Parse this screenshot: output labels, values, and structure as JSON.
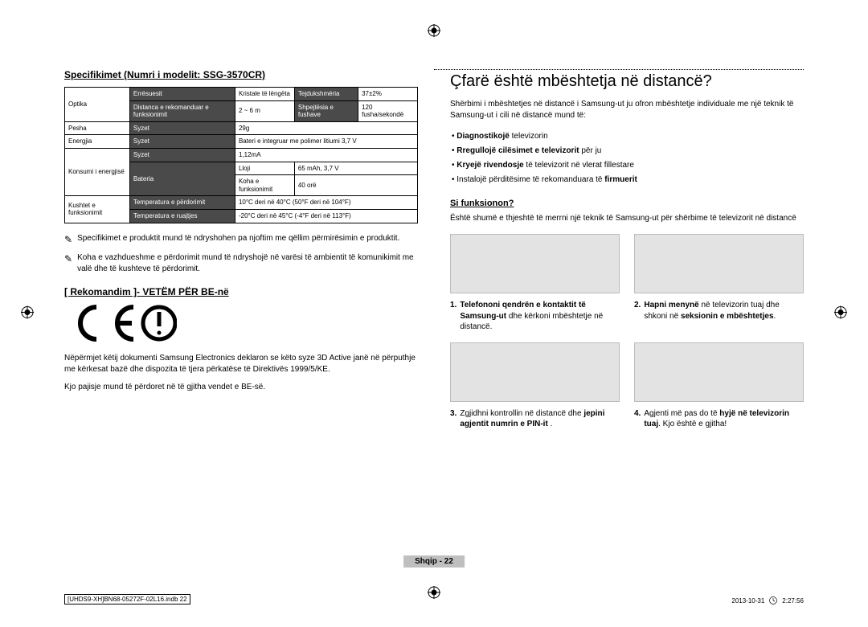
{
  "left": {
    "spec_heading": "Specifikimet (Numri i modelit: SSG-3570CR)",
    "table": {
      "r1c1": "Optika",
      "r1c2": "Errësuesit",
      "r1c3": "Kristale të lëngëta",
      "r1c4": "Tejdukshmëria",
      "r1c5": "37±2%",
      "r2c2": "Distanca e rekomanduar e funksionimit",
      "r2c3": "2 ~ 6 m",
      "r2c4": "Shpejtësia e fushave",
      "r2c5": "120 fusha/sekondë",
      "r3c1": "Pesha",
      "r3c2": "Syzet",
      "r3c3": "29g",
      "r4c1": "Energjia",
      "r4c2": "Syzet",
      "r4c3": "Bateri e integruar me polimer litiumi 3,7 V",
      "r5c1": "Konsumi i energjisë",
      "r5c2": "Syzet",
      "r5c3": "1,12mA",
      "r6c2": "Bateria",
      "r6c3a": "Lloji",
      "r6c3b": "65 mAh, 3,7 V",
      "r6c4a": "Koha e funksionimit",
      "r6c4b": "40 orë",
      "r7c1": "Kushtet e funksionimit",
      "r7c2": "Temperatura e përdorimit",
      "r7c3": "10°C deri në 40°C (50°F deri në 104°F)",
      "r8c2": "Temperatura e ruajtjes",
      "r8c3": "-20°C deri në 45°C (-4°F deri në 113°F)"
    },
    "note1": "Specifikimet e produktit mund të ndryshohen pa njoftim me qëllim përmirësimin e produktit.",
    "note2": "Koha e vazhdueshme e përdorimit mund të ndryshojë në varësi të ambientit të komunikimit me valë dhe të kushteve të përdorimit.",
    "rec_heading": "[ Rekomandim ]- VETËM PËR BE-në",
    "para1": "Nëpërmjet këtij dokumenti Samsung Electronics deklaron se këto syze 3D Active janë në përputhje me kërkesat bazë dhe dispozita të tjera përkatëse të Direktivës 1999/5/KE.",
    "para2": "Kjo pajisje mund të përdoret në të gjitha vendet e BE-së."
  },
  "right": {
    "title": "Çfarë është mbështetja në distancë?",
    "intro": "Shërbimi i mbështetjes në distancë i Samsung-ut ju ofron mbështetje individuale me një teknik të Samsung-ut i cili në distancë mund të:",
    "items": [
      {
        "b": "Diagnostikojë",
        "t": " televizorin"
      },
      {
        "b": "Rregullojë cilësimet e televizorit",
        "t": " për ju"
      },
      {
        "b": "Kryejë rivendosje",
        "t": " të televizorit në vlerat fillestare"
      },
      {
        "b": "",
        "t": "Instalojë përditësime të rekomanduara të ",
        "b2": "firmuerit"
      }
    ],
    "sub": "Si funksionon?",
    "para": "Është shumë e thjeshtë të merrni një teknik të Samsung-ut për shërbime të televizorit në distancë",
    "img1": "laptop-phone",
    "img2": "tv-support-menu",
    "steps": [
      {
        "n": "1.",
        "b1": "Telefononi qendrën e kontaktit të Samsung-ut",
        "t": " dhe kërkoni mbështetje në distancë."
      },
      {
        "n": "2.",
        "b1": "Hapni menynë",
        "t": " në televizorin tuaj dhe shkoni në ",
        "b2": "seksionin e mbështetjes",
        "t2": "."
      },
      {
        "n": "3.",
        "t0": "Zgjidhni kontrollin në distancë dhe ",
        "b1": "jepini agjentit numrin e PIN-it",
        "t": " ."
      },
      {
        "n": "4.",
        "t0": "Agjenti më pas do të ",
        "b1": "hyjë në televizorin tuaj",
        "t": ". Kjo është e gjitha!"
      }
    ]
  },
  "footer": {
    "page": "Shqip - 22",
    "file": "[UHDS9-XH]BN68-05272F-02L16.indb   22",
    "datetime": "2013-10-31   ",
    "clock": "2:27:56"
  }
}
